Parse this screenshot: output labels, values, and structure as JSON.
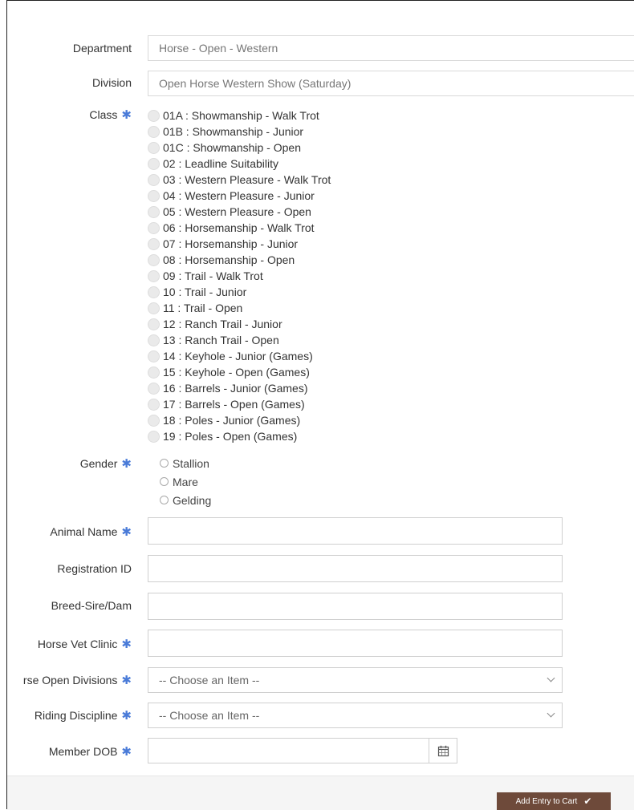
{
  "form": {
    "department": {
      "label": "Department",
      "value": "Horse - Open - Western"
    },
    "division": {
      "label": "Division",
      "value": "Open Horse Western Show (Saturday)"
    },
    "class": {
      "label": "Class",
      "options": [
        "01A : Showmanship - Walk Trot",
        "01B : Showmanship - Junior",
        "01C : Showmanship - Open",
        "02 : Leadline Suitability",
        "03 : Western Pleasure - Walk Trot",
        "04 : Western Pleasure - Junior",
        "05 : Western Pleasure - Open",
        "06 : Horsemanship - Walk Trot",
        "07 : Horsemanship - Junior",
        "08 : Horsemanship - Open",
        "09 : Trail - Walk Trot",
        "10 : Trail - Junior",
        "11 : Trail - Open",
        "12 : Ranch Trail - Junior",
        "13 : Ranch Trail - Open",
        "14 : Keyhole - Junior (Games)",
        "15 : Keyhole - Open (Games)",
        "16 : Barrels - Junior (Games)",
        "17 : Barrels - Open (Games)",
        "18 : Poles - Junior (Games)",
        "19 : Poles - Open (Games)"
      ]
    },
    "gender": {
      "label": "Gender",
      "options": [
        "Stallion",
        "Mare",
        "Gelding"
      ]
    },
    "animal_name": {
      "label": "Animal Name",
      "value": ""
    },
    "registration_id": {
      "label": "Registration ID",
      "value": ""
    },
    "breed_sire_dam": {
      "label": "Breed-Sire/Dam",
      "value": ""
    },
    "horse_vet_clinic": {
      "label": "Horse Vet Clinic",
      "value": ""
    },
    "horse_open_divisions": {
      "label": "rse Open Divisions",
      "value": "-- Choose an Item --"
    },
    "riding_discipline": {
      "label": "Riding Discipline",
      "value": "-- Choose an Item --"
    },
    "member_dob": {
      "label": "Member DOB",
      "value": ""
    },
    "required_marker": "✱"
  },
  "footer": {
    "add_to_cart_label": "Add Entry to Cart",
    "add_to_cart_icon": "checkmark-icon"
  },
  "colors": {
    "required": "#4a7bd8",
    "cart_button": "#6e4a3a"
  }
}
